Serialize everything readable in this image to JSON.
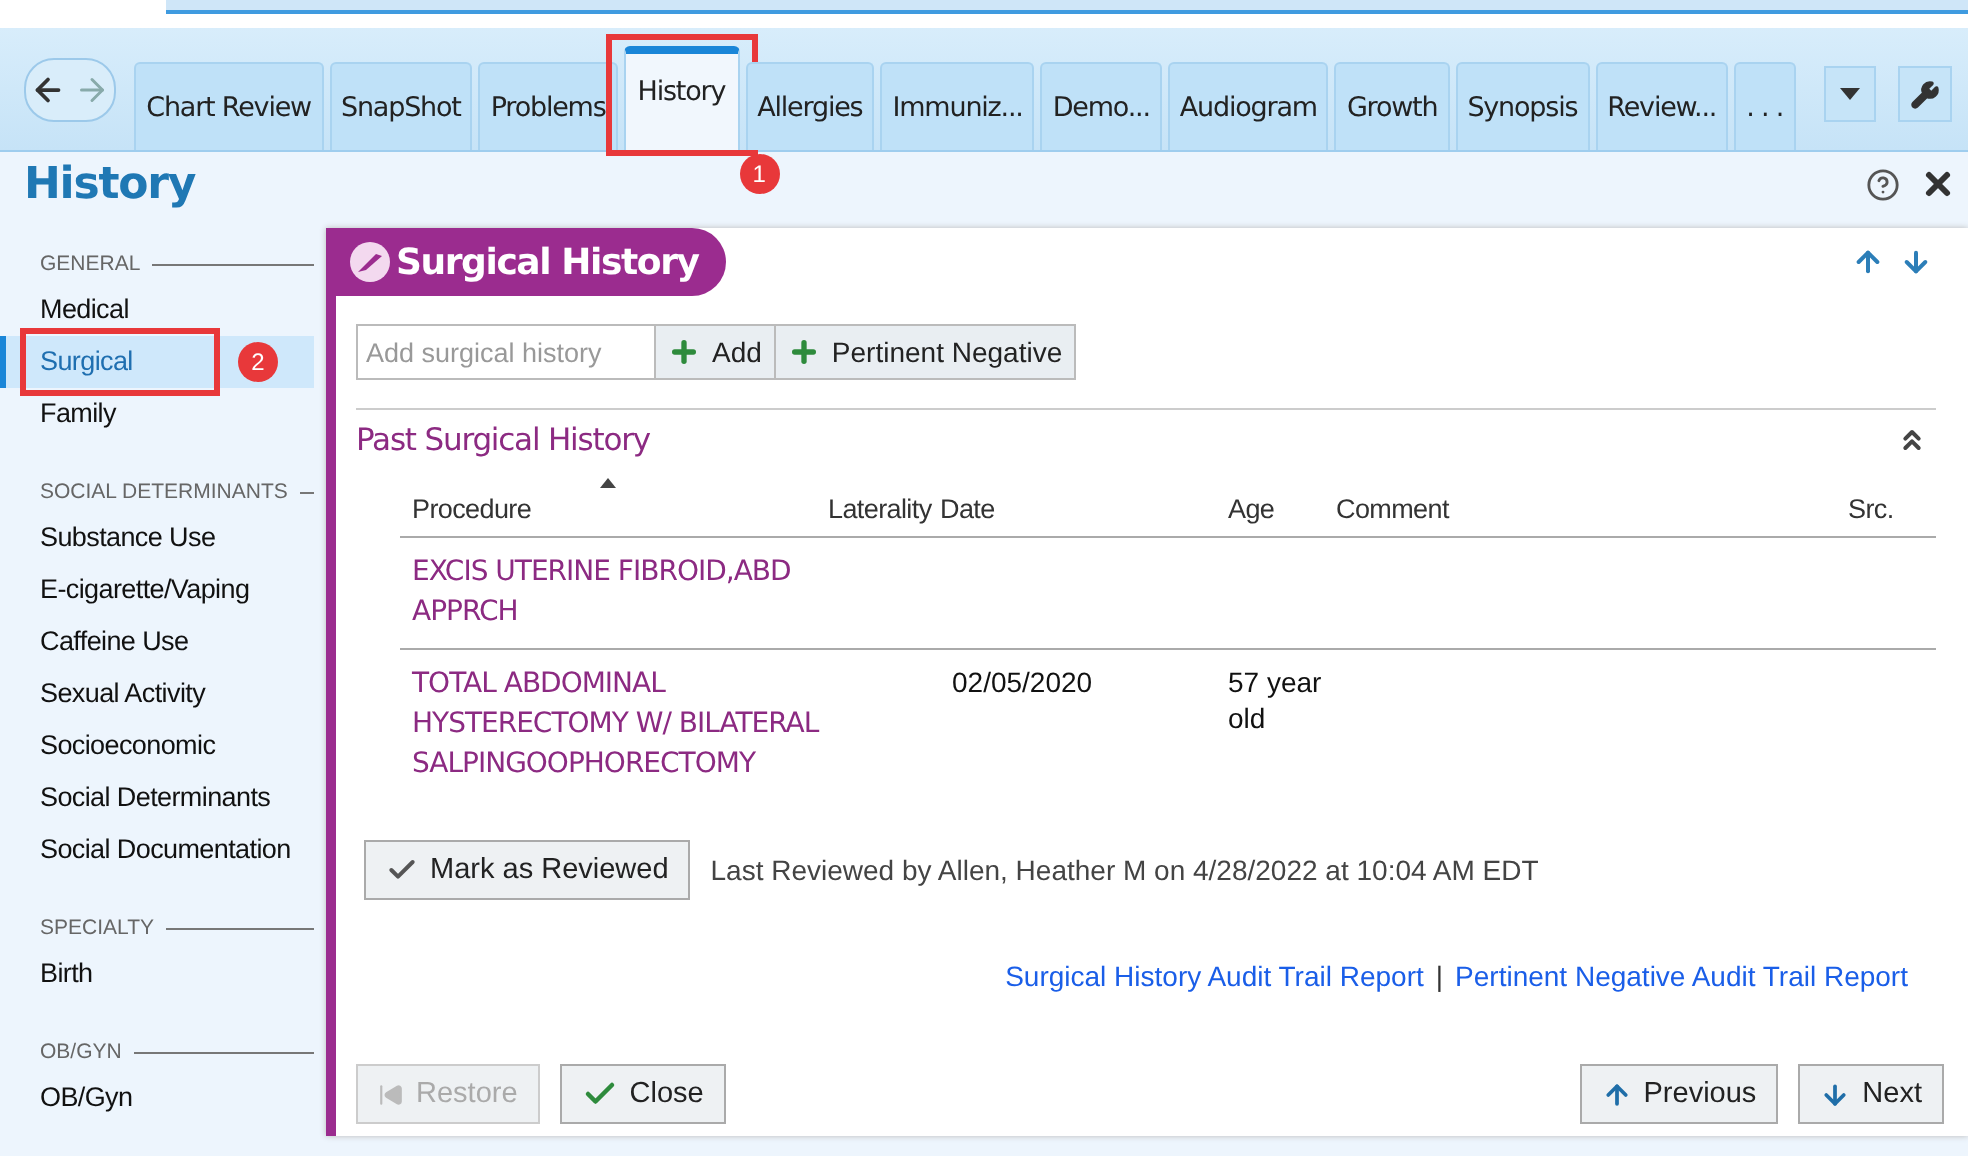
{
  "tabs": [
    {
      "label": "Chart Review",
      "selected": false
    },
    {
      "label": "SnapShot",
      "selected": false
    },
    {
      "label": "Problems",
      "selected": false
    },
    {
      "label": "History",
      "selected": true,
      "callout": "1"
    },
    {
      "label": "Allergies",
      "selected": false
    },
    {
      "label": "Immuniz...",
      "selected": false
    },
    {
      "label": "Demo...",
      "selected": false
    },
    {
      "label": "Audiogram",
      "selected": false
    },
    {
      "label": "Growth",
      "selected": false
    },
    {
      "label": "Synopsis",
      "selected": false
    },
    {
      "label": "Review...",
      "selected": false
    },
    {
      "label": ". . .",
      "selected": false
    }
  ],
  "page_title": "History",
  "sidebar": {
    "sections": [
      {
        "heading": "GENERAL",
        "items": [
          {
            "label": "Medical",
            "selected": false
          },
          {
            "label": "Surgical",
            "selected": true,
            "callout": "2"
          },
          {
            "label": "Family",
            "selected": false
          }
        ]
      },
      {
        "heading": "SOCIAL DETERMINANTS",
        "items": [
          {
            "label": "Substance Use",
            "selected": false
          },
          {
            "label": "E-cigarette/Vaping",
            "selected": false
          },
          {
            "label": "Caffeine Use",
            "selected": false
          },
          {
            "label": "Sexual Activity",
            "selected": false
          },
          {
            "label": "Socioeconomic",
            "selected": false
          },
          {
            "label": "Social Determinants",
            "selected": false
          },
          {
            "label": "Social Documentation",
            "selected": false
          }
        ]
      },
      {
        "heading": "SPECIALTY",
        "items": [
          {
            "label": "Birth",
            "selected": false
          }
        ]
      },
      {
        "heading": "OB/GYN",
        "items": [
          {
            "label": "OB/Gyn",
            "selected": false
          }
        ]
      }
    ]
  },
  "panel": {
    "title": "Surgical History",
    "add_field": {
      "placeholder": "Add surgical history"
    },
    "add_buttons": [
      "Add",
      "Pertinent Negative"
    ],
    "section_title": "Past Surgical History",
    "columns": [
      "Procedure",
      "Laterality",
      "Date",
      "Age",
      "Comment",
      "Src."
    ],
    "rows": [
      {
        "procedure": "EXCIS UTERINE FIBROID,ABD APPRCH"
      },
      {
        "procedure": "TOTAL ABDOMINAL HYSTERECTOMY W/ BILATERAL SALPINGOOPHORECTOMY",
        "date": "02/05/2020",
        "age": "57 year old"
      }
    ],
    "review_button": "Mark as Reviewed",
    "review_note": "Last Reviewed by Allen, Heather M on 4/28/2022 at 10:04 AM EDT",
    "links": [
      "Surgical History Audit Trail Report",
      "Pertinent Negative Audit Trail Report"
    ],
    "link_separator": "|",
    "footer_buttons": [
      {
        "label": "Restore",
        "kind": "restore",
        "disabled": true
      },
      {
        "label": "Close",
        "kind": "close",
        "disabled": false
      },
      {
        "label": "Previous",
        "kind": "previous",
        "disabled": false
      },
      {
        "label": "Next",
        "kind": "next",
        "disabled": false
      }
    ]
  }
}
